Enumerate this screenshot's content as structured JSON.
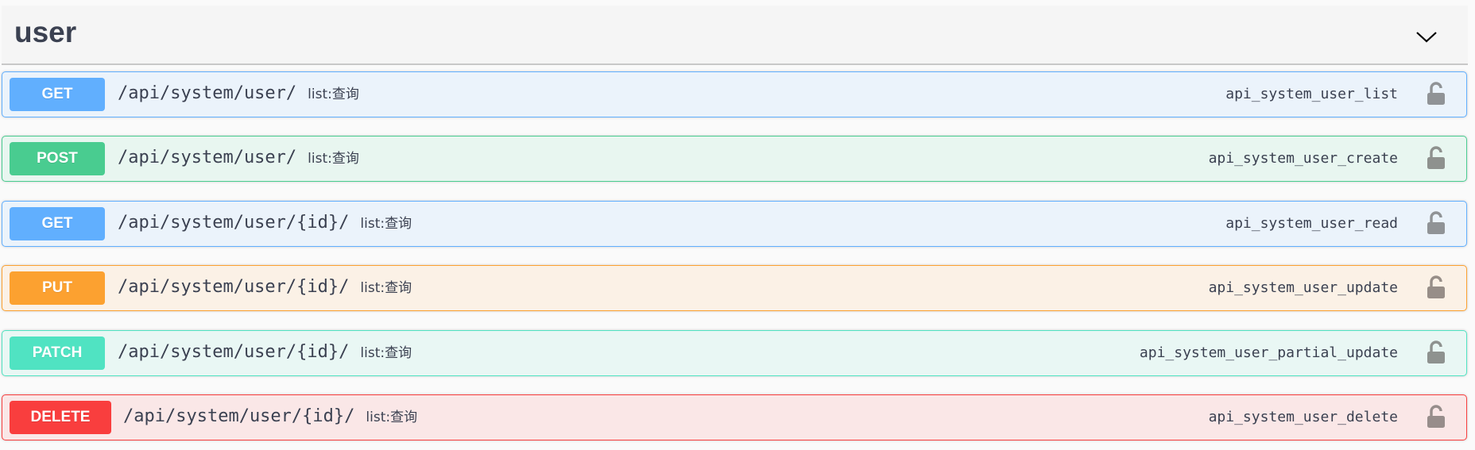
{
  "tag": {
    "title": "user"
  },
  "operations": [
    {
      "method": "GET",
      "path": "/api/system/user/",
      "summary": "list:查询",
      "operation_id": "api_system_user_list",
      "color": "#61affe",
      "bg": "#ebf3fb",
      "lock": "#909396"
    },
    {
      "method": "POST",
      "path": "/api/system/user/",
      "summary": "list:查询",
      "operation_id": "api_system_user_create",
      "color": "#49cc90",
      "bg": "#e8f6f0",
      "lock": "#8e918e"
    },
    {
      "method": "GET",
      "path": "/api/system/user/{id}/",
      "summary": "list:查询",
      "operation_id": "api_system_user_read",
      "color": "#61affe",
      "bg": "#ebf3fb",
      "lock": "#909396"
    },
    {
      "method": "PUT",
      "path": "/api/system/user/{id}/",
      "summary": "list:查询",
      "operation_id": "api_system_user_update",
      "color": "#fca130",
      "bg": "#fbf1e6",
      "lock": "#978e88"
    },
    {
      "method": "PATCH",
      "path": "/api/system/user/{id}/",
      "summary": "list:查询",
      "operation_id": "api_system_user_partial_update",
      "color": "#50e3c2",
      "bg": "#e9f7f4",
      "lock": "#8e928f"
    },
    {
      "method": "DELETE",
      "path": "/api/system/user/{id}/",
      "summary": "list:查询",
      "operation_id": "api_system_user_delete",
      "color": "#f93e3e",
      "bg": "#fae7e7",
      "lock": "#978d8b"
    }
  ]
}
